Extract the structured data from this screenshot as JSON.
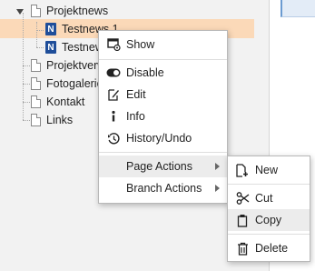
{
  "tree": {
    "items": [
      {
        "label": "Projektnews",
        "icon": "page-icon",
        "expanded": true
      },
      {
        "label": "Testnews 1",
        "icon": "news-record-icon",
        "selected": true
      },
      {
        "label": "Testnews 2",
        "icon": "news-record-icon"
      },
      {
        "label": "Projektverwaltung",
        "icon": "page-icon"
      },
      {
        "label": "Fotogalerie",
        "icon": "page-icon"
      },
      {
        "label": "Kontakt",
        "icon": "page-icon"
      },
      {
        "label": "Links",
        "icon": "page-icon"
      }
    ],
    "news_icon_letter": "N"
  },
  "context_menu": {
    "items": [
      {
        "label": "Show",
        "icon": "show-icon"
      },
      {
        "label": "Disable",
        "icon": "toggle-icon"
      },
      {
        "label": "Edit",
        "icon": "edit-icon"
      },
      {
        "label": "Info",
        "icon": "info-icon"
      },
      {
        "label": "History/Undo",
        "icon": "history-icon"
      },
      {
        "label": "Page Actions",
        "has_submenu": true
      },
      {
        "label": "Branch Actions",
        "has_submenu": true
      }
    ]
  },
  "submenu": {
    "items": [
      {
        "label": "New",
        "icon": "new-page-icon"
      },
      {
        "label": "Cut",
        "icon": "scissors-icon"
      },
      {
        "label": "Copy",
        "icon": "copy-icon"
      },
      {
        "label": "Delete",
        "icon": "trash-icon"
      }
    ]
  },
  "colors": {
    "selection": "#fbd9b8",
    "news_icon": "#1f4e9a",
    "tree_background": "#f2f2f2"
  }
}
